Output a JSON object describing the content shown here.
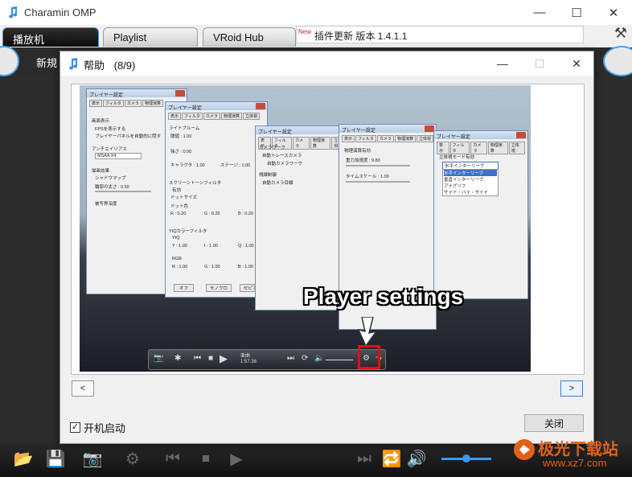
{
  "app": {
    "title": "Charamin OMP",
    "tabs": [
      {
        "label": "播放机",
        "active": true
      },
      {
        "label": "Playlist",
        "active": false
      },
      {
        "label": "VRoid Hub",
        "active": false
      }
    ],
    "update_badge": "New",
    "update_text": "插件更新 版本 1.4.1.1",
    "new_label": "新規"
  },
  "dialog": {
    "title": "帮助",
    "page_indicator": "(8/9)",
    "prev_label": "<",
    "next_label": ">",
    "startup_label": "开机启动",
    "startup_checked": true,
    "close_label": "关闭"
  },
  "screenshot": {
    "callout": "Player settings",
    "windows": [
      {
        "title": "プレイヤー設定",
        "tabs": [
          "表示",
          "フィルタ",
          "カメラ",
          "物理演算"
        ],
        "lines": [
          "画面表示",
          "FPSを表示する",
          "プレイヤーパネルを自動的に隠す",
          "アンチエイリアス",
          "MSAA X4",
          "描画効果",
          "シャドウマップ",
          "輪郭の太さ : 0.50",
          "被写界深度"
        ]
      },
      {
        "title": "プレイヤー設定",
        "tabs": [
          "表示",
          "フィルタ",
          "カメラ",
          "物理演算",
          "立体視"
        ],
        "lines": [
          "ライトブルーム",
          "閾値 : 1.00",
          "強さ : 0.00",
          "キャラクタ : 1.00",
          "ステージ : 1.00",
          "スクリーントーンフィルタ",
          "有効",
          "ドットサイズ",
          "ドット色",
          "R : 0.20",
          "G : 0.20",
          "B : 0.20",
          "YIQカラーフィルタ",
          "YIQ",
          "Y : 1.00",
          "I : 1.00",
          "Q : 1.00",
          "RGB",
          "R : 1.00",
          "G : 1.00",
          "B : 1.00",
          "オフ",
          "モノクロ",
          "セピア"
        ]
      },
      {
        "title": "プレイヤー設定",
        "tabs": [
          "表示",
          "フィルタ",
          "カメラ",
          "物理演算",
          "立体視"
        ],
        "lines": [
          "カメラワーク",
          "自動トレースカメラ",
          "自動カメラワーク",
          "視線制御",
          "自動カメラ目線"
        ]
      },
      {
        "title": "プレイヤー設定",
        "tabs": [
          "表示",
          "フィルタ",
          "カメラ",
          "物理演算",
          "立体視"
        ],
        "lines": [
          "物理演算有効",
          "重力加速度 : 9.80",
          "タイムスケール : 1.00"
        ]
      },
      {
        "title": "プレイヤー設定",
        "tabs": [
          "表示",
          "フィルタ",
          "カメラ",
          "物理演算",
          "立体視"
        ],
        "lines": [
          "立体視モード有効",
          "水平インターリーブ",
          "水平インターリーブ",
          "垂直インターリーブ",
          "アナグリフ",
          "サイド・バイ・サイド"
        ]
      }
    ],
    "player_title": "楽曲",
    "player_time": "1:57.36"
  },
  "watermark": {
    "line1": "极光下载站",
    "line2": "www.xz7.com"
  },
  "colors": {
    "accent": "#4aa3e6",
    "highlight": "#e01010",
    "watermark": "#e06218"
  },
  "icons": {
    "app": "note-icon",
    "folder": "folder-icon",
    "save": "save-icon",
    "camera": "camera-icon",
    "prev": "skip-back-icon",
    "stop": "stop-icon",
    "play": "play-icon",
    "next": "skip-forward-icon",
    "repeat": "repeat-icon",
    "volume": "volume-icon",
    "settings": "gear-icon"
  }
}
